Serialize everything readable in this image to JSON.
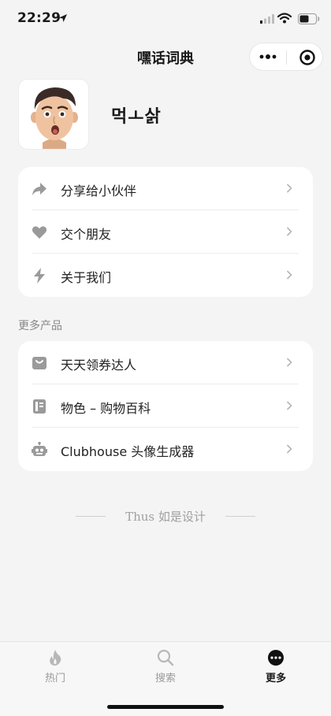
{
  "status": {
    "time": "22:29"
  },
  "nav": {
    "title": "嘿话词典"
  },
  "profile": {
    "name": "먹ㅗ삵"
  },
  "menu1": [
    {
      "label": "分享给小伙伴",
      "icon": "share-arrow-icon"
    },
    {
      "label": "交个朋友",
      "icon": "heart-icon"
    },
    {
      "label": "关于我们",
      "icon": "lightning-icon"
    }
  ],
  "section": {
    "more_products": "更多产品"
  },
  "menu2": [
    {
      "label": "天天领券达人",
      "icon": "shopping-bag-icon"
    },
    {
      "label": "物色 – 购物百科",
      "icon": "book-icon"
    },
    {
      "label": "Clubhouse 头像生成器",
      "icon": "robot-icon"
    }
  ],
  "footer": {
    "text": "Thus 如是设计"
  },
  "tabs": [
    {
      "label": "热门",
      "icon": "flame-icon",
      "active": false
    },
    {
      "label": "搜索",
      "icon": "search-icon",
      "active": false
    },
    {
      "label": "更多",
      "icon": "more-icon",
      "active": true
    }
  ],
  "colors": {
    "background": "#f4f4f4",
    "card": "#ffffff",
    "icon_gray": "#9a9a9a",
    "text": "#1a1a1a"
  }
}
